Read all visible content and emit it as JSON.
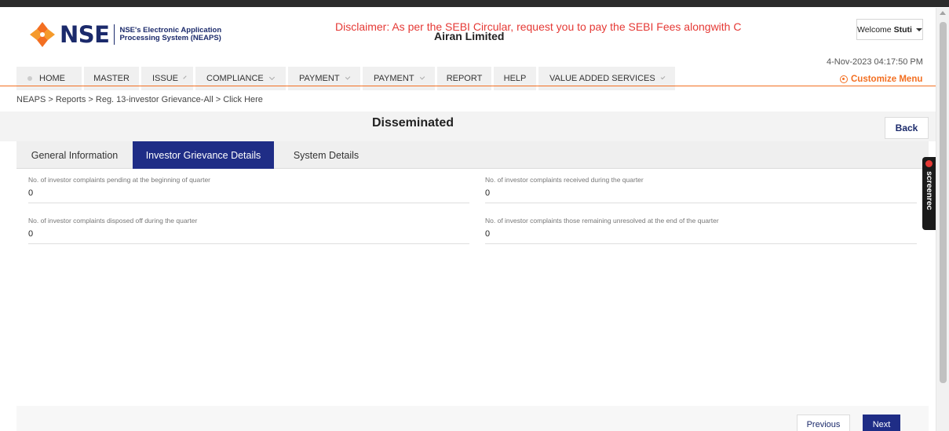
{
  "header": {
    "logo_text": "NSE",
    "logo_sub_line1": "NSE's Electronic Application",
    "logo_sub_line2": "Processing System (NEAPS)",
    "disclaimer": "Disclaimer: As per the SEBI Circular, request you to pay the SEBI Fees alongwith C",
    "company": "Airan Limited",
    "welcome_prefix": "Welcome",
    "welcome_user": "Stuti",
    "datetime": "4-Nov-2023 04:17:50 PM",
    "customize": "Customize Menu"
  },
  "nav": {
    "items": [
      {
        "label": "HOME",
        "icon": "home-dot-icon"
      },
      {
        "label": "MASTER"
      },
      {
        "label": "ISSUE",
        "dropdown": true
      },
      {
        "label": "COMPLIANCE",
        "dropdown": true
      },
      {
        "label": "PAYMENT",
        "dropdown": true
      },
      {
        "label": "PAYMENT",
        "dropdown": true
      },
      {
        "label": "REPORT"
      },
      {
        "label": "HELP"
      },
      {
        "label": "VALUE ADDED SERVICES",
        "dropdown": true
      }
    ]
  },
  "breadcrumb": "NEAPS > Reports > Reg. 13-investor Grievance-All > Click Here",
  "page": {
    "title": "Disseminated",
    "back_label": "Back"
  },
  "tabs": [
    {
      "label": "General Information",
      "active": false
    },
    {
      "label": "Investor Grievance Details",
      "active": true
    },
    {
      "label": "System Details",
      "active": false
    }
  ],
  "fields": [
    {
      "label": "No. of investor complaints pending at the beginning of quarter",
      "value": "0"
    },
    {
      "label": "No. of investor complaints received during the quarter",
      "value": "0"
    },
    {
      "label": "No. of investor complaints disposed off during the quarter",
      "value": "0"
    },
    {
      "label": "No. of investor complaints those remaining unresolved at the end of the quarter",
      "value": "0"
    }
  ],
  "footer": {
    "previous_label": "Previous",
    "next_label": "Next"
  },
  "overlay": {
    "screenrec_label": "screenrec"
  },
  "colors": {
    "accent_orange": "#f36f21",
    "brand_navy": "#1f2d86",
    "disclaimer_red": "#e53935"
  }
}
